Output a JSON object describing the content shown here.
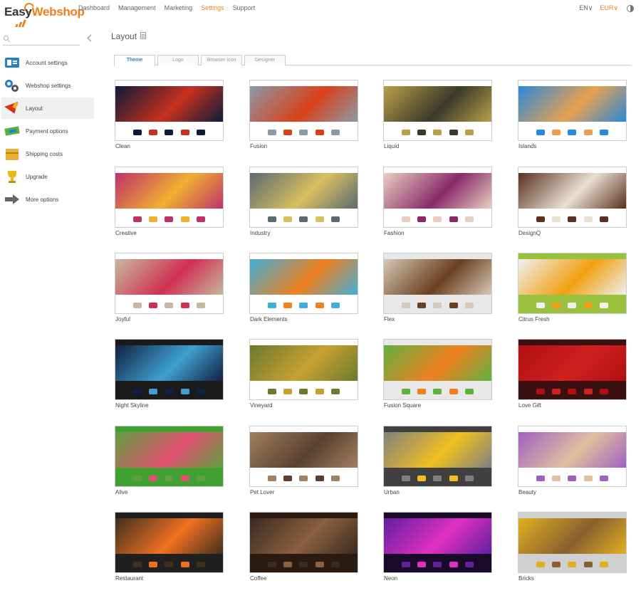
{
  "app": {
    "logo_easy": "Easy",
    "logo_web": "Webshop"
  },
  "nav": [
    "Dashboard",
    "Management",
    "Marketing",
    "Settings",
    "Support"
  ],
  "nav_active": "Settings",
  "top_right": {
    "lang": "EN",
    "currency": "EUR"
  },
  "sidebar": {
    "items": [
      {
        "label": "Account settings",
        "icon": "account-card-icon"
      },
      {
        "label": "Webshop settings",
        "icon": "gears-icon"
      },
      {
        "label": "Layout",
        "icon": "paint-brush-icon"
      },
      {
        "label": "Payment options",
        "icon": "money-icon"
      },
      {
        "label": "Shipping costs",
        "icon": "box-icon"
      },
      {
        "label": "Upgrade",
        "icon": "trophy-icon"
      },
      {
        "label": "More options",
        "icon": "arrow-right-icon"
      }
    ],
    "active": "Layout"
  },
  "page": {
    "title": "Layout"
  },
  "tabs": [
    "Theme",
    "Logo",
    "Browser icon",
    "Designer"
  ],
  "active_tab": "Theme",
  "themes": [
    {
      "name": "Clean",
      "banner": "#0d1b3a",
      "accent": "#c8301e",
      "bg": "#ffffff"
    },
    {
      "name": "Fusion",
      "banner": "#8a9aa8",
      "accent": "#d9411a",
      "bg": "#ffffff"
    },
    {
      "name": "Liquid",
      "banner": "#b8a04a",
      "accent": "#3a3a2a",
      "bg": "#ffffff"
    },
    {
      "name": "Islands",
      "banner": "#2a8ad8",
      "accent": "#e8a050",
      "bg": "#ffffff"
    },
    {
      "name": "Creative",
      "banner": "#c0306a",
      "accent": "#f0b030",
      "bg": "#ffffff"
    },
    {
      "name": "Industry",
      "banner": "#5a6a70",
      "accent": "#d8c060",
      "bg": "#ffffff"
    },
    {
      "name": "Fashion",
      "banner": "#e8d0c0",
      "accent": "#8a2a6a",
      "bg": "#ffffff"
    },
    {
      "name": "DesignQ",
      "banner": "#5a3020",
      "accent": "#e8e0d0",
      "bg": "#ffffff"
    },
    {
      "name": "Joyful",
      "banner": "#c8b8a0",
      "accent": "#d03050",
      "bg": "#ffffff"
    },
    {
      "name": "Dark Elements",
      "banner": "#40b0d8",
      "accent": "#f08020",
      "bg": "#ffffff"
    },
    {
      "name": "Flex",
      "banner": "#d8c8b8",
      "accent": "#6a4020",
      "bg": "#e8e8e8"
    },
    {
      "name": "Citrus Fresh",
      "banner": "#f0f0f0",
      "accent": "#f0a010",
      "bg": "#9ac040"
    },
    {
      "name": "Night Skyline",
      "banner": "#102040",
      "accent": "#40a0d0",
      "bg": "#1a1a1a"
    },
    {
      "name": "Vineyard",
      "banner": "#6a7a30",
      "accent": "#c8a030",
      "bg": "#ffffff"
    },
    {
      "name": "Fusion Square",
      "banner": "#60b040",
      "accent": "#f08020",
      "bg": "#e8e8e8"
    },
    {
      "name": "Love Gift",
      "banner": "#b01010",
      "accent": "#d02020",
      "bg": "#3a1010"
    },
    {
      "name": "Alive",
      "banner": "#60a040",
      "accent": "#e05070",
      "bg": "#40a030"
    },
    {
      "name": "Pet Lover",
      "banner": "#a08060",
      "accent": "#5a4030",
      "bg": "#ffffff"
    },
    {
      "name": "Urban",
      "banner": "#808080",
      "accent": "#f0c020",
      "bg": "#404040"
    },
    {
      "name": "Beauty",
      "banner": "#a060c0",
      "accent": "#e0c0a0",
      "bg": "#ffffff"
    },
    {
      "name": "Restaurant",
      "banner": "#403020",
      "accent": "#f07020",
      "bg": "#202020"
    },
    {
      "name": "Coffee",
      "banner": "#3a2a20",
      "accent": "#8a6040",
      "bg": "#2a1a10"
    },
    {
      "name": "Neon",
      "banner": "#6020a0",
      "accent": "#e030c0",
      "bg": "#1a0a2a"
    },
    {
      "name": "Bricks",
      "banner": "#e0b020",
      "accent": "#8a6030",
      "bg": "#d0d0d0"
    }
  ]
}
